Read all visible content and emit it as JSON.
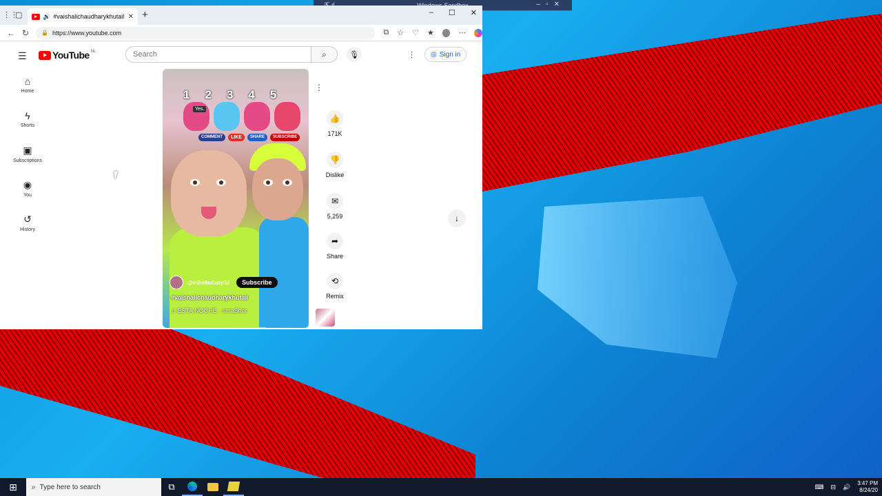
{
  "sandbox": {
    "title": "Windows Sandbox",
    "controls": [
      "–",
      "▫",
      "✕"
    ]
  },
  "browser": {
    "tab_title": "#vaishalichaudharykhutail -",
    "tab_close": "✕",
    "new_tab": "+",
    "window_controls": [
      "–",
      "☐",
      "✕"
    ],
    "url": "https://www.youtube.com"
  },
  "youtube": {
    "brand": "YouTube",
    "country": "NL",
    "search_placeholder": "Search",
    "sign_in": "Sign in",
    "sidebar": [
      {
        "label": "Home",
        "icon": "⌂"
      },
      {
        "label": "Shorts",
        "icon": "ϟ"
      },
      {
        "label": "Subscriptions",
        "icon": "▣"
      },
      {
        "label": "You",
        "icon": "◉"
      },
      {
        "label": "History",
        "icon": "↺"
      }
    ],
    "short": {
      "countdown": [
        "1",
        "2",
        "3",
        "4",
        "5"
      ],
      "yes_tag": "Yes.",
      "stickers": {
        "comment": "COMMENT",
        "like": "LIKE",
        "share": "SHARE",
        "subscribe": "SUBSCRIBE"
      },
      "channel": "@mirelledaoyiki",
      "subscribe": "Subscribe",
      "hashtag": "#vaishalichaudharykhutail",
      "music": "ESTA NOCHE · smaSher"
    },
    "actions": {
      "likes": "171K",
      "dislike": "Dislike",
      "comments": "5,259",
      "share": "Share",
      "remix": "Remix"
    }
  },
  "taskbar": {
    "search_placeholder": "Type here to search",
    "clock_time": "3:47 PM",
    "clock_date": "8/24/20"
  }
}
